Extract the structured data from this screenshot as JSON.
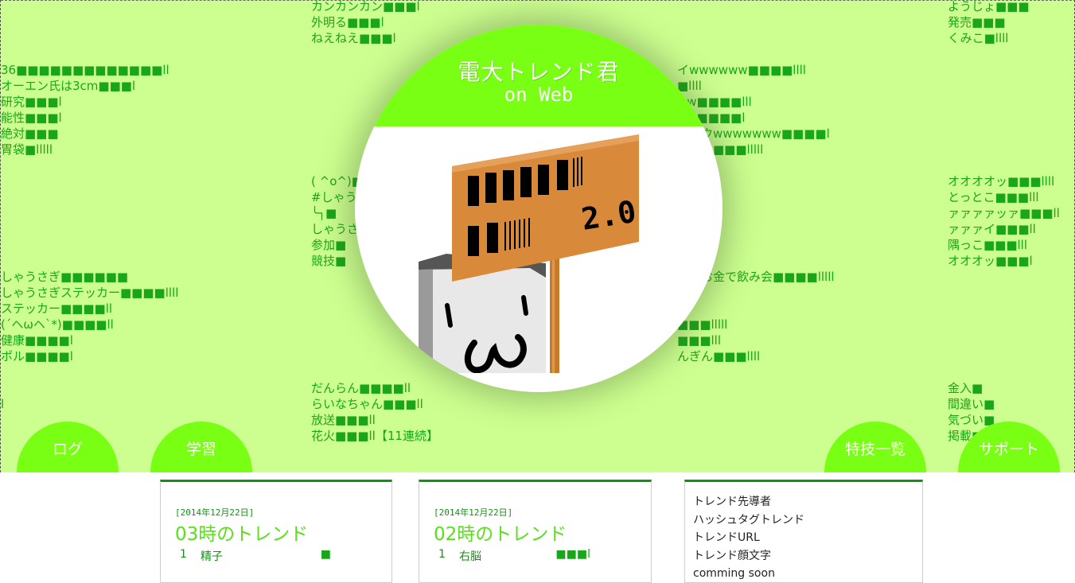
{
  "background_text": {
    "col_a": [
      "36■■■■■■■■■■■■■ll",
      "オーエン氏は3cm■■■l",
      "研究■■■l",
      "能性■■■l",
      "絶対■■■",
      "胃袋■lllll",
      "",
      "",
      "",
      "",
      "",
      "",
      "",
      "しゃうさぎ■■■■■■",
      "しゃうさぎステッカー■■■■llll",
      "ステッカー■■■■ll",
      "(´ヘωヘ`*)■■■■ll",
      "健康■■■■l",
      "ポル■■■■l",
      "",
      "",
      "l"
    ],
    "col_b": [
      "カンカンカン■■■l",
      "外明る■■■l",
      "ねえねえ■■■l",
      "",
      "",
      "",
      "",
      "",
      "",
      "",
      "",
      "( ^o^)■",
      "#しゃう",
      "╰┐■",
      "しゃうさ",
      "参加■",
      "競技■",
      "",
      "",
      "",
      "",
      "",
      "",
      "",
      "だんらん■■■■ll",
      "らいなちゃん■■■ll",
      "放送■■■ll",
      "花火■■■ll【11連続】"
    ],
    "col_c": [
      "イwwwwww■■■■llll",
      "■llll",
      "ww■■■■lll",
      "ww■■■■l",
      "ーーウwwwwwww■■■■l",
      "ーーウ■■■lllll",
      "",
      "",
      "",
      "",
      "",
      "",
      "",
      "ッのお金で飲み会■■■■lllll",
      "■ll",
      "",
      "■■■lllll",
      "■■■lll",
      "んぎん■■■llll"
    ],
    "col_d": [
      "ようじょ■■■",
      "発売■■■",
      "くみこ■llll",
      "",
      "",
      "",
      "",
      "",
      "",
      "",
      "",
      "オオオオッ■■■llll",
      "とっとこ■■■lll",
      "ァァァァッァ■■■ll",
      "ァァァイ■■■ll",
      "隅っこ■■■lll",
      "オオオッ■■■l",
      "",
      "",
      "",
      "",
      "",
      "",
      "",
      "金入■",
      "間違い■",
      "気づい■",
      "掲載■"
    ]
  },
  "logo": {
    "title": "電大トレンド君",
    "subtitle": "on Web",
    "sign_version": "2.0"
  },
  "nav": {
    "log": "ログ",
    "study": "学習",
    "skills": "特技一覧",
    "support": "サポート"
  },
  "cards": [
    {
      "date": "[2014年12月22日]",
      "title": "03時のトレンド",
      "rank": "1",
      "word": "精子",
      "value": "■"
    },
    {
      "date": "[2014年12月22日]",
      "title": "02時のトレンド",
      "rank": "1",
      "word": "右脳",
      "value": "■■■l"
    }
  ],
  "menu": [
    "トレンド先導者",
    "ハッシュタグトレンド",
    "トレンドURL",
    "トレンド顔文字",
    "comming soon"
  ],
  "colors": {
    "accent": "#78ff14",
    "hero_bg": "#ccff90",
    "text_green": "#1aa61a",
    "border_green": "#149114"
  }
}
